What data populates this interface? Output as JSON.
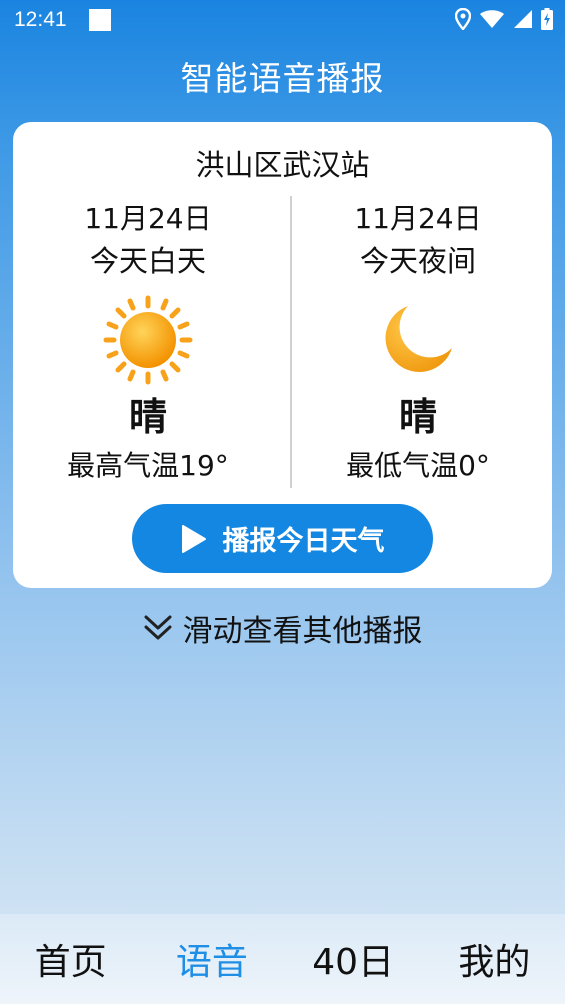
{
  "status_bar": {
    "time": "12:41",
    "icons": [
      "location-icon",
      "wifi-icon",
      "signal-icon",
      "battery-icon"
    ]
  },
  "app_title": "智能语音播报",
  "card": {
    "station": "洪山区武汉站",
    "day": {
      "date": "11月24日",
      "period": "今天白天",
      "icon": "sun-icon",
      "condition": "晴",
      "temp_label": "最高气温19°"
    },
    "night": {
      "date": "11月24日",
      "period": "今天夜间",
      "icon": "moon-icon",
      "condition": "晴",
      "temp_label": "最低气温0°"
    },
    "play_button_label": "播报今日天气"
  },
  "swipe_hint": "滑动查看其他播报",
  "bottom_nav": {
    "items": [
      {
        "label": "首页",
        "active": false
      },
      {
        "label": "语音",
        "active": true
      },
      {
        "label": "40日",
        "active": false
      },
      {
        "label": "我的",
        "active": false
      }
    ]
  },
  "colors": {
    "accent": "#1387e2",
    "nav_active": "#1f8fe6",
    "sun": "#f5a623",
    "moon": "#f4a61f"
  }
}
